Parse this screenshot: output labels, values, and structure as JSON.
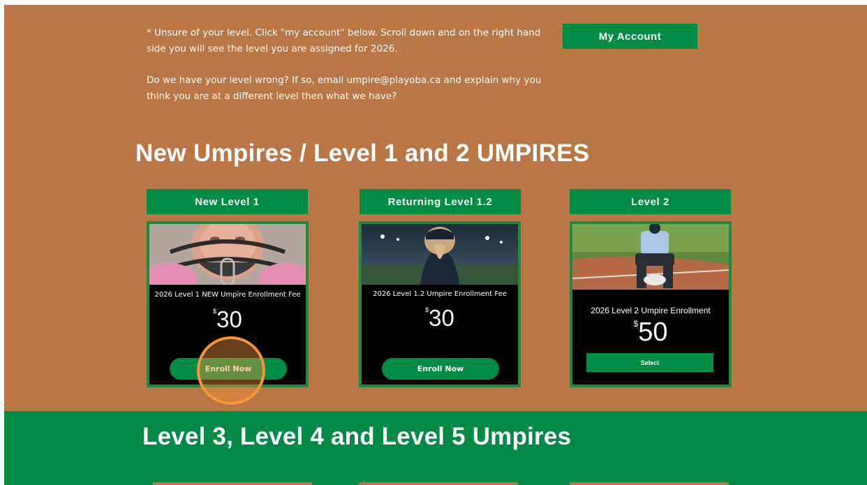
{
  "info": {
    "line1": "*  Unsure of your level.  Click \"my account\" below.  Scroll down and on the right hand side you will see the level you are assigned for 2026.",
    "line2": "Do we have your level wrong?  If so, email umpire@playoba.ca and explain why you think you are at a different level then what we have?"
  },
  "account_button": "My Account",
  "section1": {
    "heading": "New Umpires / Level 1 and 2 UMPIRES",
    "cards": [
      {
        "tab": "New Level 1",
        "title": "2026 Level 1 NEW Umpire Enrollment Fee",
        "currency": "$",
        "price": "30",
        "button": "Enroll Now"
      },
      {
        "tab": "Returning Level 1.2",
        "title": "2026 Level 1.2 Umpire Enrollment Fee",
        "currency": "$",
        "price": "30",
        "button": "Enroll Now"
      },
      {
        "tab": "Level 2",
        "title": "2026 Level 2 Umpire Enrollment",
        "currency": "$",
        "price": "50",
        "button": "Select"
      }
    ]
  },
  "section2": {
    "heading": "Level 3, Level 4 and Level 5 Umpires"
  },
  "colors": {
    "background": "#ba7645",
    "green": "#008c45",
    "card": "#000000",
    "highlight": "#f7953c"
  }
}
